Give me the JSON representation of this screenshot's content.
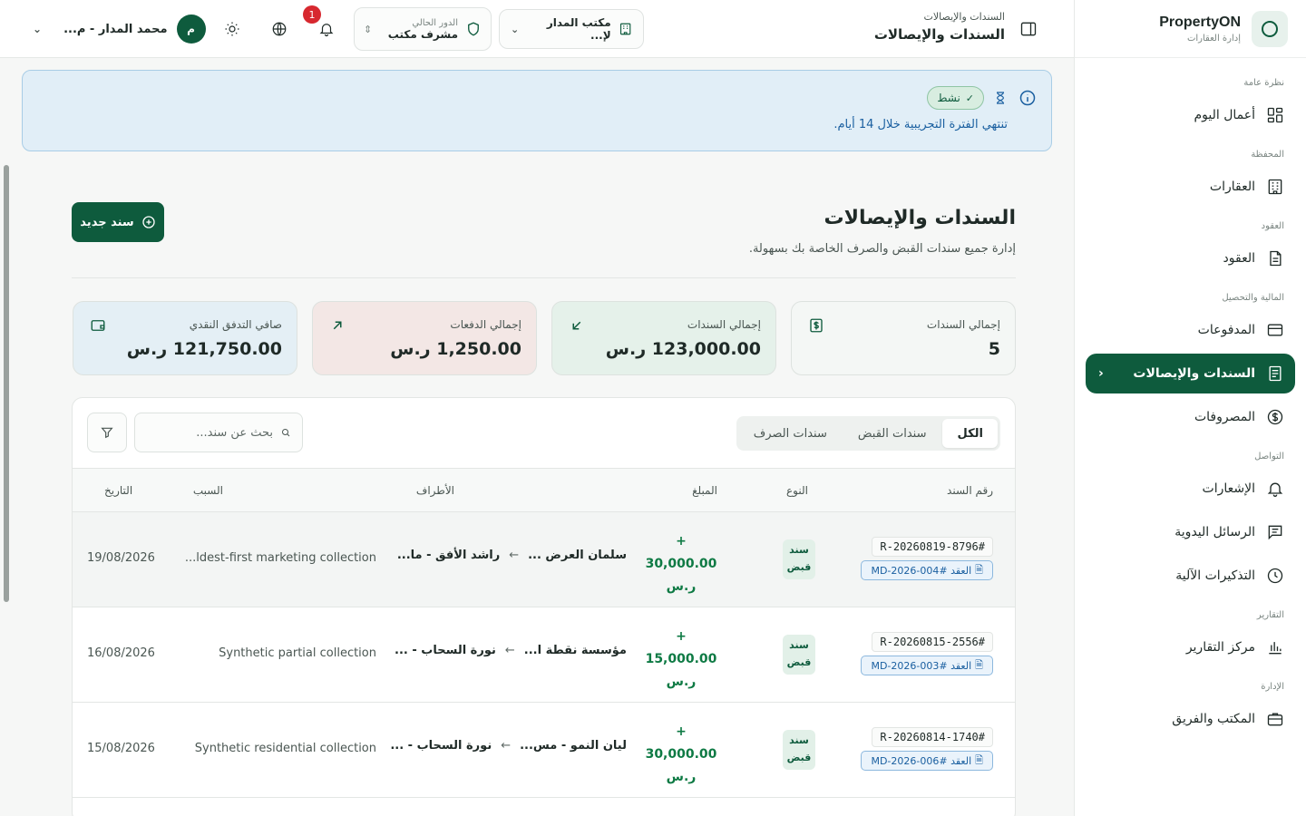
{
  "brand": {
    "name": "PropertyON",
    "subtitle": "إدارة العقارات"
  },
  "sidebar": {
    "groups": [
      {
        "label": "نظرة عامة",
        "items": [
          {
            "label": "أعمال اليوم",
            "icon": "dashboard-grid-icon"
          }
        ]
      },
      {
        "label": "المحفظة",
        "items": [
          {
            "label": "العقارات",
            "icon": "building-icon"
          }
        ]
      },
      {
        "label": "العقود",
        "items": [
          {
            "label": "العقود",
            "icon": "document-icon"
          }
        ]
      },
      {
        "label": "المالية والتحصيل",
        "items": [
          {
            "label": "المدفوعات",
            "icon": "wallet-icon"
          },
          {
            "label": "السندات والإيصالات",
            "icon": "receipt-icon",
            "active": true
          },
          {
            "label": "المصروفات",
            "icon": "dollar-circle-icon"
          }
        ]
      },
      {
        "label": "التواصل",
        "items": [
          {
            "label": "الإشعارات",
            "icon": "bell-icon"
          },
          {
            "label": "الرسائل اليدوية",
            "icon": "message-icon"
          },
          {
            "label": "التذكيرات الآلية",
            "icon": "clock-icon"
          }
        ]
      },
      {
        "label": "التقارير",
        "items": [
          {
            "label": "مركز التقارير",
            "icon": "bar-chart-icon"
          }
        ]
      },
      {
        "label": "الإدارة",
        "items": [
          {
            "label": "المكتب والفريق",
            "icon": "briefcase-icon"
          }
        ]
      }
    ]
  },
  "topbar": {
    "breadcrumb_small": "السندات والإيصالات",
    "breadcrumb_title": "السندات والإيصالات",
    "office_selector": "مكتب المدار لإ...",
    "role_label": "الدور الحالي",
    "role_value": "مشرف مكتب",
    "notifications_count": "1",
    "user_name": "محمد المدار - م...",
    "user_initial": "م"
  },
  "trial_banner": {
    "status_badge": "نشط",
    "message": "تنتهي الفترة التجريبية خلال 14 أيام."
  },
  "page": {
    "title": "السندات والإيصالات",
    "subtitle": "إدارة جميع سندات القبض والصرف الخاصة بك بسهولة.",
    "new_button": "سند جديد"
  },
  "stats": [
    {
      "label": "إجمالي السندات",
      "value": "5",
      "icon": "dollar-box-icon",
      "bg": "#f4f7f5",
      "icon_color": "#0e5b3d"
    },
    {
      "label": "إجمالي السندات",
      "value": "123,000.00 ر.س",
      "icon": "arrow-down-left-icon",
      "bg": "#e5f1ea",
      "icon_color": "#0e5b3d"
    },
    {
      "label": "إجمالي الدفعات",
      "value": "1,250.00 ر.س",
      "icon": "arrow-up-right-icon",
      "bg": "#f3e7e5",
      "icon_color": "#0e5b3d"
    },
    {
      "label": "صافي التدفق النقدي",
      "value": "121,750.00 ر.س",
      "icon": "wallet-icon",
      "bg": "#e4eff5",
      "icon_color": "#0e5b3d"
    }
  ],
  "table": {
    "tabs": [
      "الكل",
      "سندات القبض",
      "سندات الصرف"
    ],
    "active_tab": 0,
    "search_placeholder": "بحث عن سند...",
    "columns": [
      "رقم السند",
      "النوع",
      "المبلغ",
      "الأطراف",
      "السبب",
      "التاريخ"
    ],
    "rows": [
      {
        "number": "R-20260819-8796#",
        "contract": "العقد #MD-2026-004",
        "type_line1": "سند",
        "type_line2": "قبض",
        "amount_sign": "+",
        "amount": "30,000.00",
        "currency": "ر.س",
        "from": "سلمان العرض ...",
        "to": "راشد الأفق - ما...",
        "reason": "...ldest-first marketing collection",
        "date": "19/08/2026"
      },
      {
        "number": "R-20260815-2556#",
        "contract": "العقد #MD-2026-003",
        "type_line1": "سند",
        "type_line2": "قبض",
        "amount_sign": "+",
        "amount": "15,000.00",
        "currency": "ر.س",
        "from": "مؤسسة نقطة ا...",
        "to": "نورة السحاب - ...",
        "reason": "Synthetic partial collection",
        "date": "16/08/2026"
      },
      {
        "number": "R-20260814-1740#",
        "contract": "العقد #MD-2026-006",
        "type_line1": "سند",
        "type_line2": "قبض",
        "amount_sign": "+",
        "amount": "30,000.00",
        "currency": "ر.س",
        "from": "ليان النمو - مس...",
        "to": "نورة السحاب - ...",
        "reason": "Synthetic residential collection",
        "date": "15/08/2026"
      }
    ]
  },
  "colors": {
    "primary": "#0e5b3d",
    "positive": "#0e7a44",
    "info": "#1a5fa0",
    "badge": "#d7282f"
  }
}
